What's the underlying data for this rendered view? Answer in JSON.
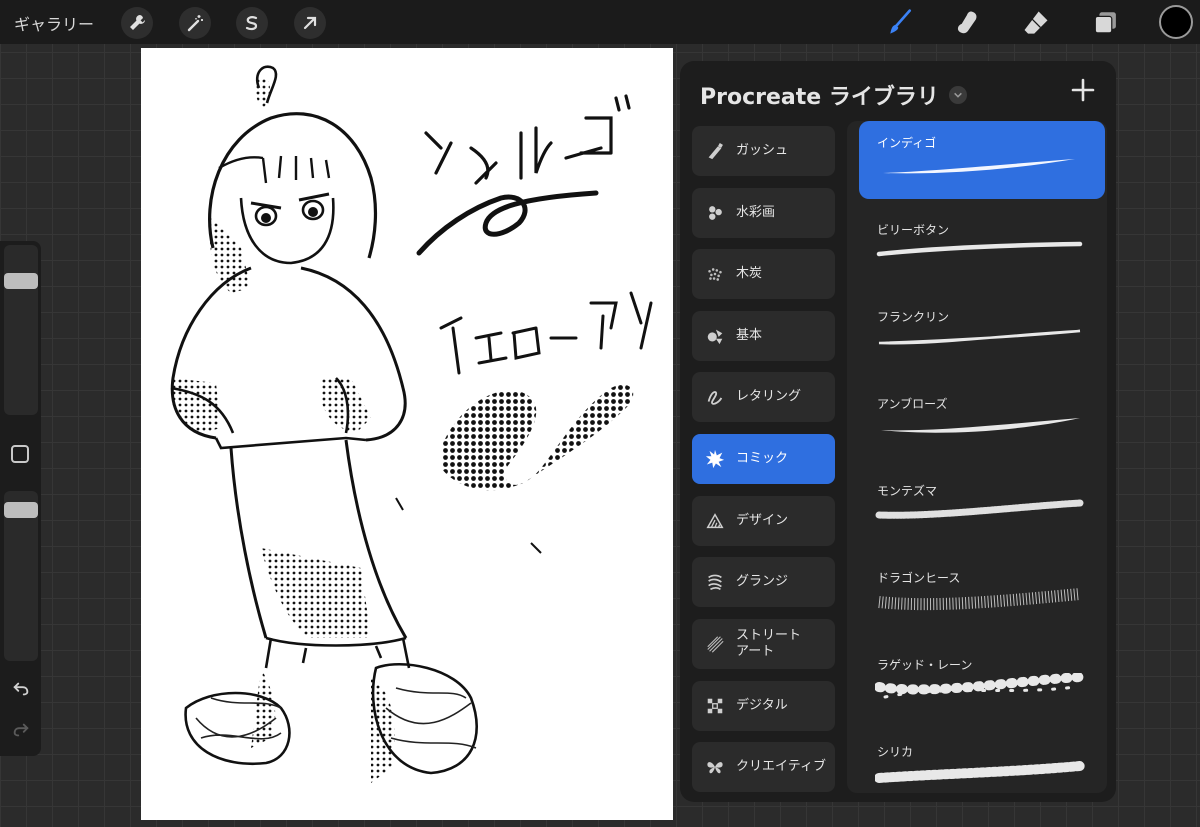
{
  "topbar": {
    "gallery_label": "ギャラリー",
    "actions_icon": "wrench-icon",
    "adjustments_icon": "magic-wand-icon",
    "selection_icon": "selection-s-icon",
    "transform_icon": "arrow-cursor-icon",
    "brush_icon": "brush-icon",
    "smudge_icon": "smudge-finger-icon",
    "eraser_icon": "eraser-icon",
    "layers_icon": "layers-icon",
    "current_color": "#000000"
  },
  "sidebar": {
    "size_level": 0.82,
    "opacity_level": 0.93
  },
  "canvas": {
    "logo_text": ""
  },
  "library": {
    "title": "Procreate ライブラリ",
    "accent_color": "#2f6fe0",
    "categories": [
      {
        "label": "ガッシュ",
        "icon": "gouache-tube-icon"
      },
      {
        "label": "水彩画",
        "icon": "watercolor-dots-icon"
      },
      {
        "label": "木炭",
        "icon": "charcoal-icon"
      },
      {
        "label": "基本",
        "icon": "basic-shapes-icon"
      },
      {
        "label": "レタリング",
        "icon": "lettering-icon"
      },
      {
        "label": "コミック",
        "icon": "comic-burst-icon",
        "selected": true
      },
      {
        "label": "デザイン",
        "icon": "design-triangle-icon"
      },
      {
        "label": "グランジ",
        "icon": "grunge-icon"
      },
      {
        "label": "ストリート\nアート",
        "icon": "street-art-icon"
      },
      {
        "label": "デジタル",
        "icon": "digital-icon"
      },
      {
        "label": "クリエイティブ",
        "icon": "creative-butterfly-icon"
      }
    ],
    "brushes": [
      {
        "name": "インディゴ",
        "selected": true
      },
      {
        "name": "ビリーボタン"
      },
      {
        "name": "フランクリン"
      },
      {
        "name": "アンブローズ"
      },
      {
        "name": "モンテズマ"
      },
      {
        "name": "ドラゴンヒース"
      },
      {
        "name": "ラゲッド・レーン"
      },
      {
        "name": "シリカ"
      }
    ]
  }
}
